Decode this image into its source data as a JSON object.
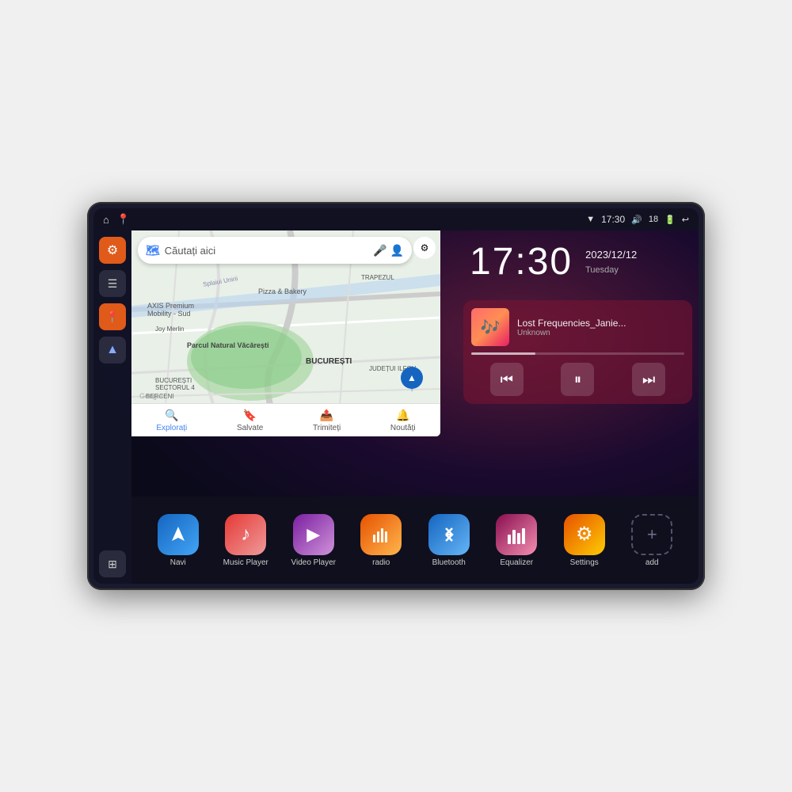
{
  "device": {
    "statusBar": {
      "time": "17:30",
      "battery": "18",
      "leftIcons": [
        "⌂",
        "📍"
      ]
    },
    "clock": {
      "time": "17:30",
      "date": "2023/12/12",
      "weekday": "Tuesday"
    },
    "music": {
      "trackName": "Lost Frequencies_Janie...",
      "artist": "Unknown",
      "albumArtEmoji": "🎵"
    },
    "map": {
      "searchPlaceholder": "Căutați aici",
      "bottomItems": [
        {
          "label": "Explorați",
          "icon": "🔍",
          "active": true
        },
        {
          "label": "Salvate",
          "icon": "🔖",
          "active": false
        },
        {
          "label": "Trimiteți",
          "icon": "📤",
          "active": false
        },
        {
          "label": "Noutăți",
          "icon": "🔔",
          "active": false
        }
      ],
      "mapLabels": [
        "AXIS Premium Mobility - Sud",
        "Pizza & Bakery",
        "Parcul Natural Văcărești",
        "BUCUREȘTI",
        "SECTORUL 4",
        "JUDEȚUI ILFOV",
        "BERCENI",
        "Joy Merlin",
        "Splaiui Unirii",
        "TRAPEZUL"
      ]
    },
    "apps": [
      {
        "label": "Navi",
        "iconClass": "navi",
        "icon": "▲"
      },
      {
        "label": "Music Player",
        "iconClass": "music",
        "icon": "♪"
      },
      {
        "label": "Video Player",
        "iconClass": "video",
        "icon": "▶"
      },
      {
        "label": "radio",
        "iconClass": "radio",
        "icon": "📻"
      },
      {
        "label": "Bluetooth",
        "iconClass": "bluetooth",
        "icon": "⚡"
      },
      {
        "label": "Equalizer",
        "iconClass": "equalizer",
        "icon": "📊"
      },
      {
        "label": "Settings",
        "iconClass": "settings",
        "icon": "⚙"
      },
      {
        "label": "add",
        "iconClass": "add",
        "icon": "+"
      }
    ],
    "sidebar": {
      "icons": [
        {
          "icon": "⚙",
          "style": "orange",
          "name": "settings"
        },
        {
          "icon": "☰",
          "style": "dark",
          "name": "menu"
        },
        {
          "icon": "📍",
          "style": "orange",
          "name": "location"
        },
        {
          "icon": "▲",
          "style": "dark",
          "name": "navigate"
        }
      ]
    }
  }
}
